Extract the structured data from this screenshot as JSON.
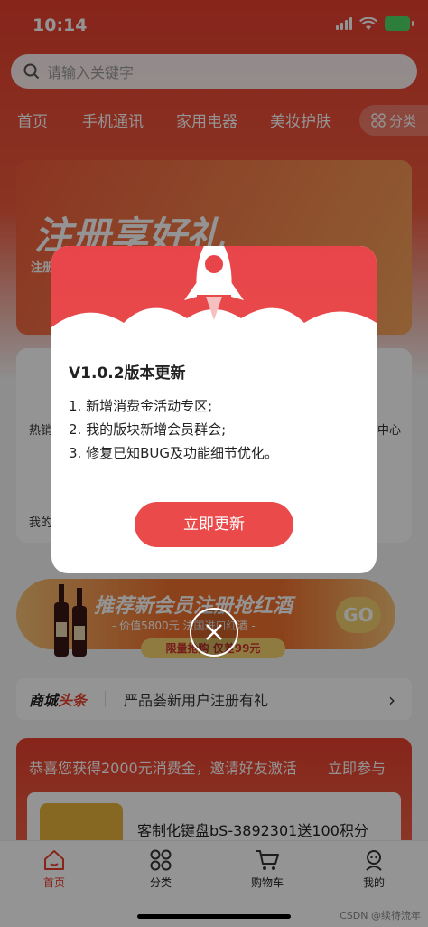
{
  "status_bar": {
    "time": "10:14"
  },
  "search": {
    "placeholder": "请输入关键字"
  },
  "nav": {
    "tabs": [
      "首页",
      "手机通讯",
      "家用电器",
      "美妆护肤"
    ],
    "category_label": "分类"
  },
  "banner": {
    "title": "注册享好礼",
    "sub": "注册"
  },
  "icon_panel": {
    "labels": [
      "热销",
      "中心",
      "我的"
    ]
  },
  "promo": {
    "title": "推荐新会员注册抢红酒",
    "sub": "- 价值5800元 法国进口红酒 -",
    "tag": "限量抢购 仅差99元",
    "badge": "GO"
  },
  "news": {
    "brand_a": "商城",
    "brand_b": "头条",
    "text": "严品荟新用户注册有礼"
  },
  "invite": {
    "text": "恭喜您获得2000元消费金，邀请好友激活",
    "join": "立即参与",
    "product_name": "客制化键盘bS-3892301送100积分"
  },
  "modal": {
    "title": "V1.0.2版本更新",
    "items": [
      "1. 新增消费金活动专区;",
      "2. 我的版块新增会员群会;",
      "3. 修复已知BUG及功能细节优化。"
    ],
    "button": "立即更新"
  },
  "tabbar": {
    "items": [
      {
        "label": "首页",
        "icon": "home-icon",
        "active": true
      },
      {
        "label": "分类",
        "icon": "grid-icon",
        "active": false
      },
      {
        "label": "购物车",
        "icon": "cart-icon",
        "active": false
      },
      {
        "label": "我的",
        "icon": "user-icon",
        "active": false
      }
    ]
  },
  "watermark": "CSDN @续待流年",
  "colors": {
    "brand_red": "#e8402f",
    "button_red": "#ea4a4a"
  }
}
